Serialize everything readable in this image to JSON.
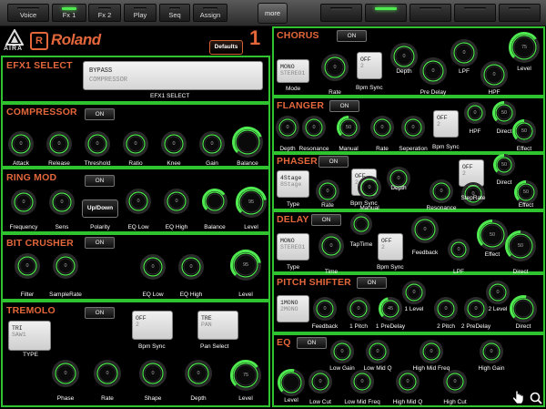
{
  "tabs": [
    "Voice",
    "Fx 1",
    "Fx 2",
    "Play",
    "Seq",
    "Assign"
  ],
  "more_label": "more",
  "brand": {
    "logo_text": "AIRA",
    "roland": "Roland",
    "defaults": "Defaults",
    "fx_number": "1"
  },
  "on_label": "ON",
  "efx1": {
    "title": "EFX1 SELECT",
    "line1": "BYPASS",
    "line2": "COMPRESSOR",
    "caption": "EFX1 SELECT"
  },
  "compressor": {
    "title": "COMPRESSOR"
  },
  "ringmod": {
    "title": "RING MOD",
    "polarity": "Up/Down"
  },
  "bitcrusher": {
    "title": "BIT CRUSHER"
  },
  "tremolo": {
    "title": "TREMOLO",
    "type1": "TRI",
    "type2": "SAW1",
    "type_label": "TYPE",
    "bpm1": "OFF",
    "bpm2": "2",
    "bpm_label": "Bpm Sync",
    "pan1": "TRE",
    "pan2": "PAN",
    "pan_label": "Pan Select"
  },
  "chorus": {
    "title": "CHORUS",
    "mode1": "MONO",
    "mode2": "STEREO1",
    "bpm1": "OFF",
    "bpm2": "2"
  },
  "flanger": {
    "title": "FLANGER",
    "bpm1": "OFF",
    "bpm2": "2"
  },
  "phaser": {
    "title": "PHASER",
    "type1": "4Stage",
    "type2": "8Stage",
    "bpm1": "OFF",
    "bpm2": "2",
    "step1": "OFF",
    "step2": "2"
  },
  "delay": {
    "title": "DELAY",
    "type1": "MONO",
    "type2": "STEREO1",
    "bpm1": "OFF",
    "bpm2": "2"
  },
  "pitch": {
    "title": "PITCH SHIFTER",
    "mode1": "1MONO",
    "mode2": "2MONO"
  },
  "eq": {
    "title": "EQ"
  },
  "colors": {
    "panel": "#2fc42f",
    "title": "#e4673b",
    "led": "#4fea4f"
  },
  "knobs": [
    {
      "v": "0",
      "l": "Attack"
    },
    {
      "v": "0",
      "l": "Release"
    },
    {
      "v": "0",
      "l": "Threshold"
    },
    {
      "v": "0",
      "l": "Ratio"
    },
    {
      "v": "0",
      "l": "Knee"
    },
    {
      "v": "0",
      "l": "Gain"
    },
    {
      "v": "",
      "l": "Balance",
      "lvl": 0.75
    },
    {
      "v": "0",
      "l": "Frequency"
    },
    {
      "v": "0",
      "l": "Sens"
    },
    {
      "v": "",
      "l": "Polarity"
    },
    {
      "v": "0",
      "l": "EQ Low"
    },
    {
      "v": "0",
      "l": "EQ High"
    },
    {
      "v": "",
      "l": "Balance",
      "lvl": 0.7
    },
    {
      "v": "95",
      "l": "Level",
      "lvl": 0.8
    },
    {
      "v": "0",
      "l": "Filter"
    },
    {
      "v": "0",
      "l": "SampleRate"
    },
    {
      "v": "0",
      "l": "EQ Low"
    },
    {
      "v": "0",
      "l": "EQ High"
    },
    {
      "v": "95",
      "l": "Level",
      "lvl": 0.8
    },
    {
      "v": "0",
      "l": "Phase"
    },
    {
      "v": "0",
      "l": "Rate"
    },
    {
      "v": "0",
      "l": "Shape"
    },
    {
      "v": "0",
      "l": "Depth"
    },
    {
      "v": "75",
      "l": "Level",
      "lvl": 0.7
    },
    {
      "v": "0",
      "l": "Rate"
    },
    {
      "v": "0",
      "l": "Depth"
    },
    {
      "v": "0",
      "l": "Pre Delay"
    },
    {
      "v": "0",
      "l": "LPF"
    },
    {
      "v": "0",
      "l": "HPF"
    },
    {
      "v": "75",
      "l": "Level",
      "lvl": 0.7
    },
    {
      "v": "0",
      "l": "Depth"
    },
    {
      "v": "0",
      "l": "Resonance"
    },
    {
      "v": "50",
      "l": "Manual",
      "lvl": 0.5
    },
    {
      "v": "0",
      "l": "Rate"
    },
    {
      "v": "0",
      "l": "Seperation"
    },
    {
      "v": "0",
      "l": "HPF"
    },
    {
      "v": "50",
      "l": "Direct",
      "lvl": 0.5
    },
    {
      "v": "50",
      "l": "Effect",
      "lvl": 0.5
    },
    {
      "v": "0",
      "l": "Rate"
    },
    {
      "v": "0",
      "l": "Manual"
    },
    {
      "v": "0",
      "l": "Depth"
    },
    {
      "v": "0",
      "l": "Resonance"
    },
    {
      "v": "0",
      "l": "StepRate"
    },
    {
      "v": "50",
      "l": "Direct",
      "lvl": 0.5
    },
    {
      "v": "50",
      "l": "Effect",
      "lvl": 0.5
    },
    {
      "v": "",
      "l": "TapTime"
    },
    {
      "v": "0",
      "l": "Time"
    },
    {
      "v": "0",
      "l": "Feedback"
    },
    {
      "v": "0",
      "l": "LPF"
    },
    {
      "v": "50",
      "l": "Effect",
      "lvl": 0.5
    },
    {
      "v": "50",
      "l": "Direct",
      "lvl": 0.5
    },
    {
      "v": "0",
      "l": "Feedback"
    },
    {
      "v": "0",
      "l": "1 Pitch"
    },
    {
      "v": "45",
      "l": "1 PreDelay",
      "lvl": 0.45
    },
    {
      "v": "0",
      "l": "1 Level"
    },
    {
      "v": "0",
      "l": "2 Pitch"
    },
    {
      "v": "0",
      "l": "2 PreDelay"
    },
    {
      "v": "0",
      "l": "2 Level"
    },
    {
      "v": "",
      "l": "Direct",
      "lvl": 0.55
    },
    {
      "v": "",
      "l": "Level",
      "lvl": 0.55
    },
    {
      "v": "0",
      "l": "Low Gain"
    },
    {
      "v": "0",
      "l": "Low Cut"
    },
    {
      "v": "0",
      "l": "Low Mid Q"
    },
    {
      "v": "0",
      "l": "Low Mid Freq"
    },
    {
      "v": "0",
      "l": "High Mid Freq"
    },
    {
      "v": "0",
      "l": "High Mid Q"
    },
    {
      "v": "0",
      "l": "High Gain"
    },
    {
      "v": "0",
      "l": "High Cut"
    }
  ]
}
